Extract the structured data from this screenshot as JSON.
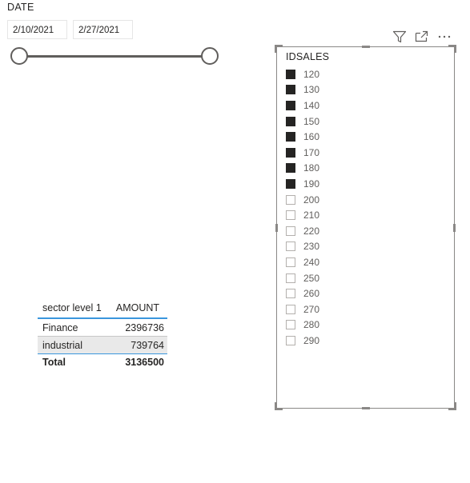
{
  "date_slicer": {
    "title": "DATE",
    "start_date": "2/10/2021",
    "end_date": "2/27/2021"
  },
  "table": {
    "headers": [
      "sector level 1",
      "AMOUNT"
    ],
    "rows": [
      {
        "sector": "Finance",
        "amount": "2396736"
      },
      {
        "sector": "industrial",
        "amount": "739764"
      }
    ],
    "total": {
      "label": "Total",
      "amount": "3136500"
    }
  },
  "idsales_slicer": {
    "title": "IDSALES",
    "items": [
      {
        "label": "120",
        "checked": true
      },
      {
        "label": "130",
        "checked": true
      },
      {
        "label": "140",
        "checked": true
      },
      {
        "label": "150",
        "checked": true
      },
      {
        "label": "160",
        "checked": true
      },
      {
        "label": "170",
        "checked": true
      },
      {
        "label": "180",
        "checked": true
      },
      {
        "label": "190",
        "checked": true
      },
      {
        "label": "200",
        "checked": false
      },
      {
        "label": "210",
        "checked": false
      },
      {
        "label": "220",
        "checked": false
      },
      {
        "label": "230",
        "checked": false
      },
      {
        "label": "240",
        "checked": false
      },
      {
        "label": "250",
        "checked": false
      },
      {
        "label": "260",
        "checked": false
      },
      {
        "label": "270",
        "checked": false
      },
      {
        "label": "280",
        "checked": false
      },
      {
        "label": "290",
        "checked": false
      }
    ]
  },
  "visual_header_icons": [
    "filter-icon",
    "focus-mode-icon",
    "more-options-icon"
  ],
  "colors": {
    "accent_blue": "#3a96dd",
    "checkbox_checked": "#252423",
    "slider": "#605e5c",
    "alt_row": "#e9e9e9"
  }
}
